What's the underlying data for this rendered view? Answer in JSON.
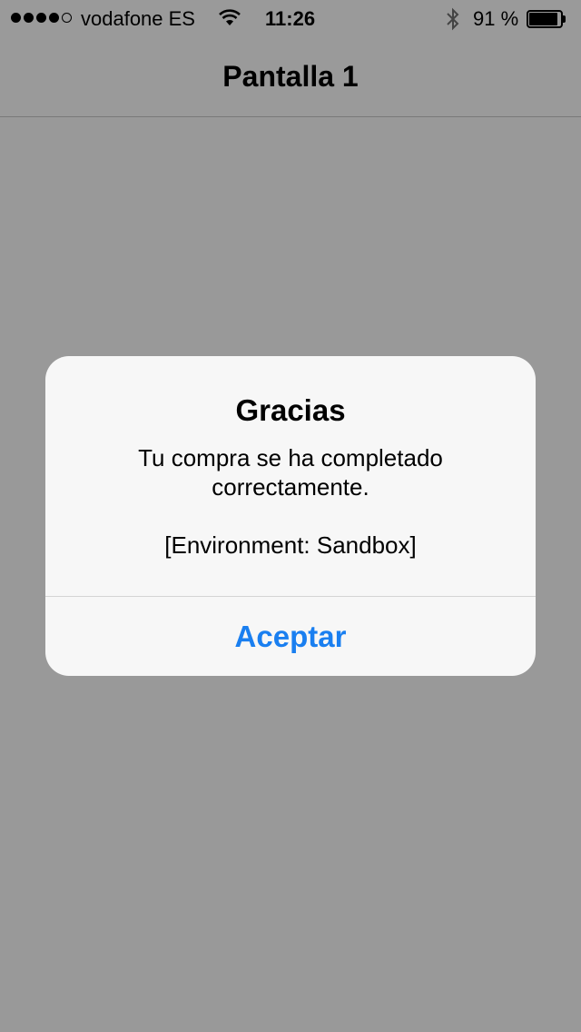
{
  "status_bar": {
    "signal_filled": 4,
    "signal_total": 5,
    "carrier": "vodafone ES",
    "time": "11:26",
    "battery_percent": "91 %",
    "battery_level": 0.91,
    "icons": [
      "signal-dots-icon",
      "wifi-icon",
      "bluetooth-icon",
      "battery-icon"
    ]
  },
  "nav": {
    "title": "Pantalla 1"
  },
  "alert": {
    "title": "Gracias",
    "message": "Tu compra se ha completado\ncorrectamente.\n\n[Environment: Sandbox]",
    "action_label": "Aceptar",
    "action_color": "#1a7ff0"
  },
  "colors": {
    "overlay_background": "#999999",
    "alert_background": "#f7f7f7"
  }
}
